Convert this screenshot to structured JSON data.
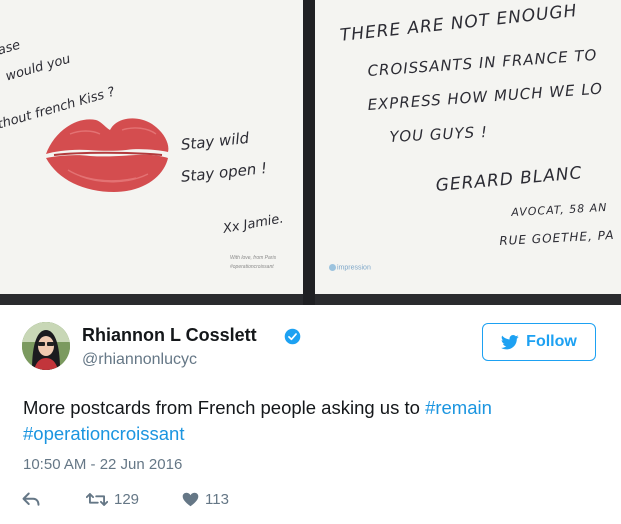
{
  "postcards": {
    "left": {
      "question_lines": [
        "ase",
        "would you",
        "thout french Kiss ?"
      ],
      "stay_wild": "Stay wild",
      "stay_open": "Stay open !",
      "signature": "Xx Jamie.",
      "small_print_1": "With love, from Paris",
      "small_print_2": "#operationcroissant"
    },
    "right": {
      "lines": [
        "THERE ARE NOT ENOUGH",
        "CROISSANTS IN FRANCE TO",
        "EXPRESS HOW MUCH WE LO",
        "YOU GUYS !"
      ],
      "sig_name": "GERARD BLANC",
      "sig_line_1": "AVOCAT, 58 AN",
      "sig_line_2": "RUE GOETHE, PA",
      "brand": "impression"
    }
  },
  "tweet": {
    "display_name": "Rhiannon L Cosslett",
    "handle": "@rhiannonlucyc",
    "follow_label": "Follow",
    "text_plain": "More postcards from French people asking us to ",
    "hashtag_1": "#remain",
    "hashtag_2": "#operationcroissant",
    "timestamp": "10:50 AM - 22 Jun 2016",
    "retweet_count": "129",
    "like_count": "113"
  },
  "colors": {
    "accent": "#1da1f2",
    "hashtag": "#1b95e0",
    "muted": "#657786",
    "lipstick": "#d44d4f"
  },
  "icons": {
    "verified": "verified-badge-icon",
    "follow": "twitter-bird-icon",
    "reply": "reply-icon",
    "retweet": "retweet-icon",
    "like": "heart-icon"
  }
}
